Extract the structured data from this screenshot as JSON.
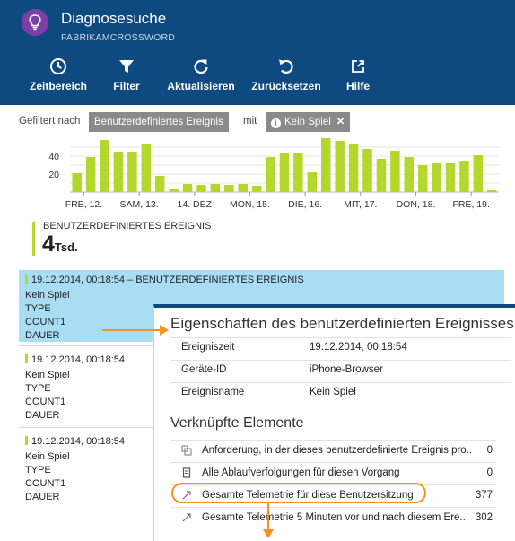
{
  "app": {
    "title": "Diagnosesuche",
    "subtitle": "FABRIKAMCROSSWORD",
    "icon": "lightbulb-icon"
  },
  "toolbar": [
    {
      "label": "Zeitbereich",
      "icon": "clock-icon"
    },
    {
      "label": "Filter",
      "icon": "filter-icon"
    },
    {
      "label": "Aktualisieren",
      "icon": "refresh-icon"
    },
    {
      "label": "Zurücksetzen",
      "icon": "undo-icon"
    },
    {
      "label": "Hilfe",
      "icon": "external-link-icon"
    }
  ],
  "filter": {
    "prefix": "Gefiltert nach",
    "chip_type": "Benutzerdefiniertes Ereignis",
    "connector": "mit",
    "chip_value": "Kein Spiel",
    "chip_remove": "✕"
  },
  "chart_data": {
    "type": "bar",
    "ylabels": [
      "40",
      "20"
    ],
    "ygrid": [
      50,
      40,
      30,
      20,
      10
    ],
    "ylim": [
      0,
      60
    ],
    "color": "#b5d62c",
    "x_tick_labels": [
      "FRE, 12.",
      "SAM, 13.",
      "14. DEZ",
      "MON, 15.",
      "DIE, 16.",
      "MIT, 17.",
      "DON, 18.",
      "FRE, 19."
    ],
    "values": [
      21,
      39,
      58,
      45,
      45,
      53,
      18,
      3,
      9,
      8,
      9,
      8,
      9,
      7,
      39,
      43,
      43,
      22,
      60,
      57,
      54,
      48,
      37,
      46,
      39,
      30,
      32,
      32,
      34,
      41,
      2
    ]
  },
  "metric": {
    "label": "BENUTZERDEFINIERTES EREIGNIS",
    "value": "4",
    "unit": "Tsd."
  },
  "events": [
    {
      "date": "19.12.2014, 00:18:54 – BENUTZERDEFINIERTES EREIGNIS",
      "name": "Kein Spiel",
      "fields": [
        "TYPE",
        "COUNT1",
        "DAUER"
      ]
    },
    {
      "date": "19.12.2014, 00:18:54",
      "name": "Kein Spiel",
      "fields": [
        "TYPE",
        "COUNT1",
        "DAUER"
      ]
    },
    {
      "date": "19.12.2014, 00:18:54",
      "name": "Kein Spiel",
      "fields": [
        "TYPE",
        "COUNT1",
        "DAUER"
      ]
    }
  ],
  "panel": {
    "title": "Eigenschaften des benutzerdefinierten Ereignisses",
    "properties": [
      {
        "key": "Ereigniszeit",
        "value": "19.12.2014, 00:18:54"
      },
      {
        "key": "Geräte-ID",
        "value": "iPhone-Browser"
      },
      {
        "key": "Ereignisname",
        "value": "Kein Spiel"
      }
    ],
    "related_title": "Verknüpfte Elemente",
    "related": [
      {
        "icon": "request-icon",
        "text": "Anforderung, in der dieses benutzerdefinierte Ereignis pro...",
        "count": "0"
      },
      {
        "icon": "document-icon",
        "text": "Alle Ablaufverfolgungen für diesen Vorgang",
        "count": "0"
      },
      {
        "icon": "telemetry-icon",
        "text": "Gesamte Telemetrie für diese Benutzersitzung",
        "count": "377"
      },
      {
        "icon": "telemetry-icon",
        "text": "Gesamte Telemetrie 5 Minuten vor und nach diesem Ere...",
        "count": "302"
      }
    ]
  },
  "colors": {
    "header": "#0e4a80",
    "accent_green": "#b5d62c",
    "selected": "#a9ddf3",
    "annotation": "#f29222"
  }
}
